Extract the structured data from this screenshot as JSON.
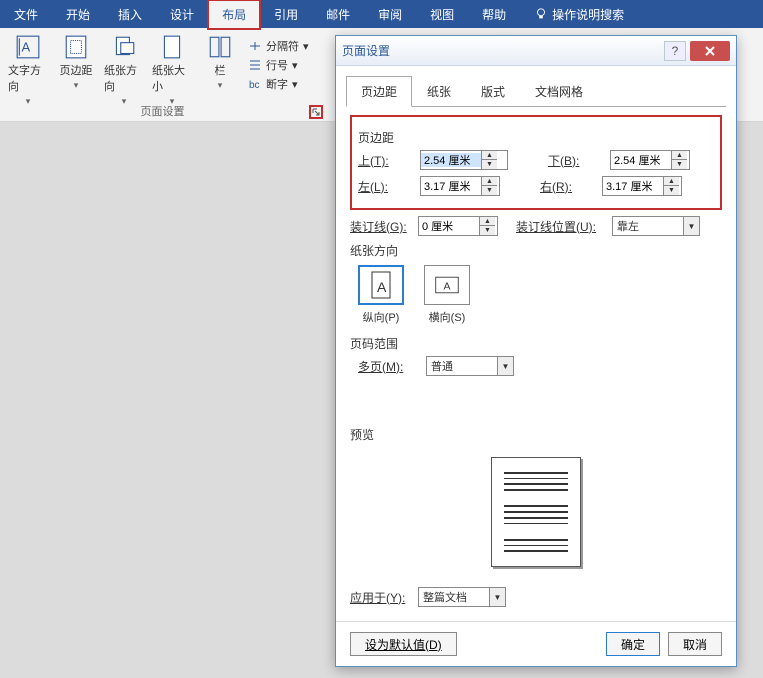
{
  "ribbon": {
    "tabs": [
      "文件",
      "开始",
      "插入",
      "设计",
      "布局",
      "引用",
      "邮件",
      "审阅",
      "视图",
      "帮助"
    ],
    "active_tab_index": 4,
    "tell_me": "操作说明搜索",
    "groups": {
      "page_setup": {
        "label": "页面设置",
        "items": {
          "text_direction": "文字方向",
          "margins": "页边距",
          "orientation": "纸张方向",
          "size": "纸张大小",
          "columns": "栏"
        },
        "small": {
          "breaks": "分隔符",
          "line_numbers": "行号",
          "hyphenation": "断字"
        }
      }
    }
  },
  "dialog": {
    "title": "页面设置",
    "tabs": [
      "页边距",
      "纸张",
      "版式",
      "文档网格"
    ],
    "active_tab_index": 0,
    "margins": {
      "section": "页边距",
      "top_label": "上(T):",
      "top_value": "2.54 厘米",
      "bottom_label": "下(B):",
      "bottom_value": "2.54 厘米",
      "left_label": "左(L):",
      "left_value": "3.17 厘米",
      "right_label": "右(R):",
      "right_value": "3.17 厘米",
      "gutter_label": "装订线(G):",
      "gutter_value": "0 厘米",
      "gutter_pos_label": "装订线位置(U):",
      "gutter_pos_value": "靠左"
    },
    "orientation": {
      "section": "纸张方向",
      "portrait": "纵向(P)",
      "landscape": "横向(S)"
    },
    "pages": {
      "section": "页码范围",
      "multi_label": "多页(M):",
      "multi_value": "普通"
    },
    "preview": {
      "section": "预览"
    },
    "apply": {
      "label": "应用于(Y):",
      "value": "整篇文档"
    },
    "footer": {
      "default": "设为默认值(D)",
      "ok": "确定",
      "cancel": "取消"
    }
  }
}
